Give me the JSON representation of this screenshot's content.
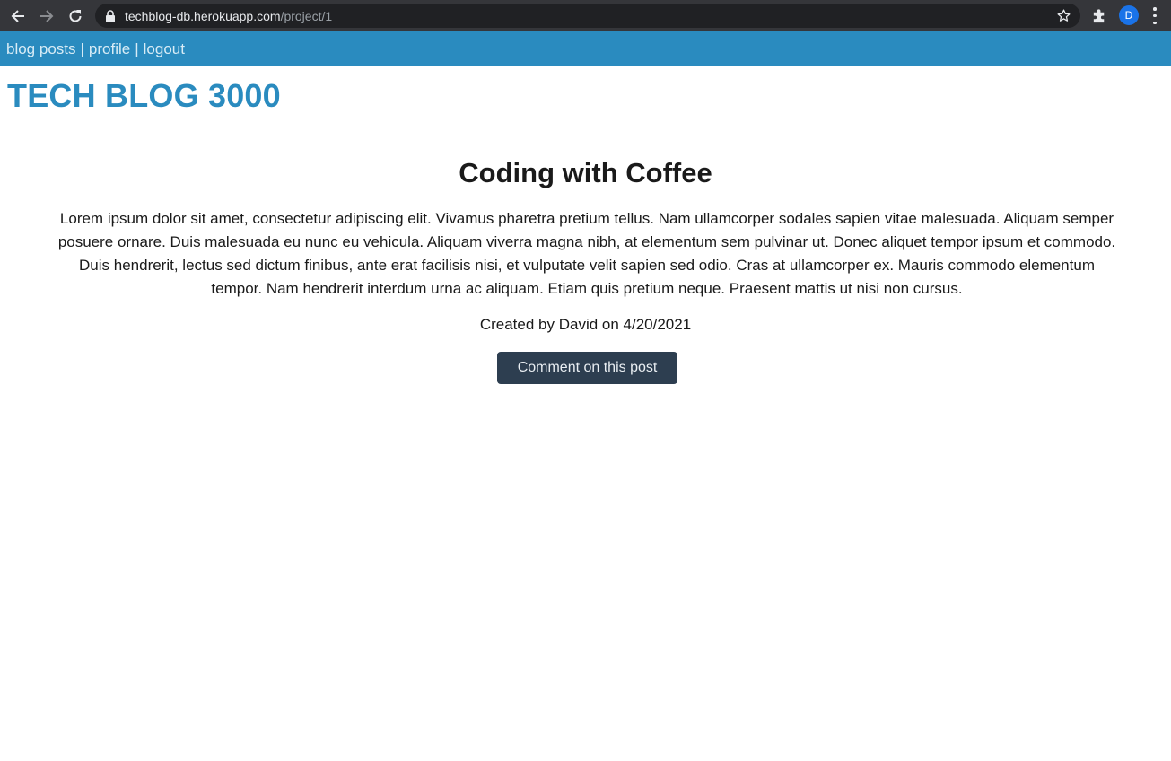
{
  "browser": {
    "url_host": "techblog-db.herokuapp.com",
    "url_path": "/project/1",
    "profile_initial": "D"
  },
  "nav": {
    "items": [
      {
        "label": "blog posts"
      },
      {
        "label": "profile"
      },
      {
        "label": "logout"
      }
    ],
    "separator": "|"
  },
  "site": {
    "brand": "TECH BLOG 3000"
  },
  "post": {
    "title": "Coding with Coffee",
    "body": "Lorem ipsum dolor sit amet, consectetur adipiscing elit. Vivamus pharetra pretium tellus. Nam ullamcorper sodales sapien vitae malesuada. Aliquam semper posuere ornare. Duis malesuada eu nunc eu vehicula. Aliquam viverra magna nibh, at elementum sem pulvinar ut. Donec aliquet tempor ipsum et commodo. Duis hendrerit, lectus sed dictum finibus, ante erat facilisis nisi, et vulputate velit sapien sed odio. Cras at ullamcorper ex. Mauris commodo elementum tempor. Nam hendrerit interdum urna ac aliquam. Etiam quis pretium neque. Praesent mattis ut nisi non cursus.",
    "meta": "Created by David on 4/20/2021",
    "comment_button": "Comment on this post"
  },
  "colors": {
    "nav_bg": "#2a8bbf",
    "brand": "#2a8bbf",
    "button_bg": "#2d3e50"
  },
  "icons": [
    "back-arrow-icon",
    "forward-arrow-icon",
    "reload-icon",
    "lock-icon",
    "star-icon",
    "puzzle-extension-icon",
    "kebab-menu-icon"
  ]
}
